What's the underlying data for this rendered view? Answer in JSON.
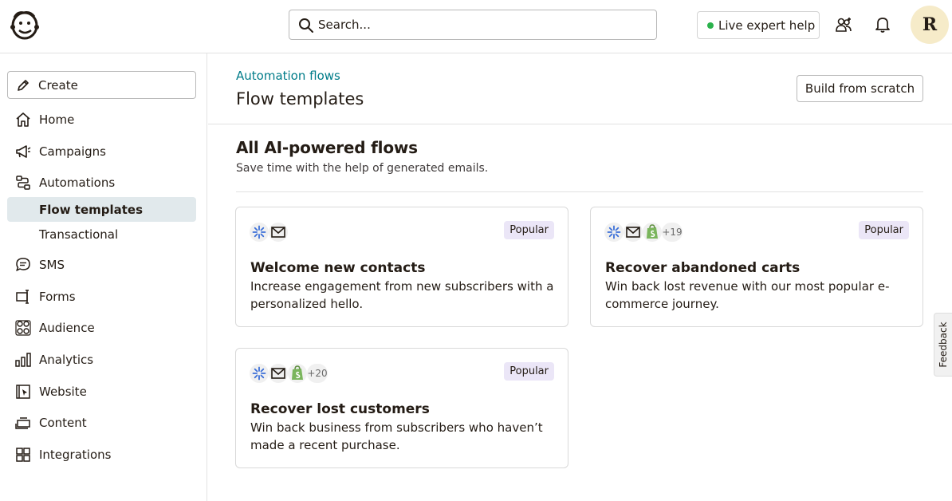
{
  "topbar": {
    "search_placeholder": "Search...",
    "live_help_label": "Live expert help",
    "avatar_initial": "R"
  },
  "sidebar": {
    "create_label": "Create",
    "items": [
      {
        "label": "Home",
        "icon": "home-icon"
      },
      {
        "label": "Campaigns",
        "icon": "megaphone-icon"
      },
      {
        "label": "Automations",
        "icon": "automation-icon"
      },
      {
        "label": "SMS",
        "icon": "sms-icon"
      },
      {
        "label": "Forms",
        "icon": "forms-icon"
      },
      {
        "label": "Audience",
        "icon": "audience-icon"
      },
      {
        "label": "Analytics",
        "icon": "analytics-icon"
      },
      {
        "label": "Website",
        "icon": "website-icon"
      },
      {
        "label": "Content",
        "icon": "content-icon"
      },
      {
        "label": "Integrations",
        "icon": "integrations-icon"
      }
    ],
    "subitems": [
      {
        "label": "Flow templates",
        "active": true
      },
      {
        "label": "Transactional",
        "active": false
      }
    ]
  },
  "header": {
    "breadcrumb": "Automation flows",
    "title": "Flow templates",
    "build_button": "Build from scratch"
  },
  "section": {
    "title": "All AI-powered flows",
    "subtitle": "Save time with the help of generated emails."
  },
  "cards": [
    {
      "title": "Welcome new contacts",
      "description": "Increase engagement from new subscribers with a personalized hello.",
      "badge": "Popular",
      "icons": [
        "ai-sparkle-icon",
        "mail-icon"
      ],
      "more": ""
    },
    {
      "title": "Recover abandoned carts",
      "description": "Win back lost revenue with our most popular e-commerce journey.",
      "badge": "Popular",
      "icons": [
        "ai-sparkle-icon",
        "mail-icon",
        "shopify-icon"
      ],
      "more": "+19"
    },
    {
      "title": "Recover lost customers",
      "description": "Win back business from subscribers who haven’t made a recent purchase.",
      "badge": "Popular",
      "icons": [
        "ai-sparkle-icon",
        "mail-icon",
        "shopify-icon"
      ],
      "more": "+20"
    }
  ],
  "feedback_label": "Feedback",
  "colors": {
    "accent": "#007c89",
    "active_bg": "#e1e9ec",
    "badge_bg": "#ebe6f7",
    "live_dot": "#2bb24c"
  }
}
